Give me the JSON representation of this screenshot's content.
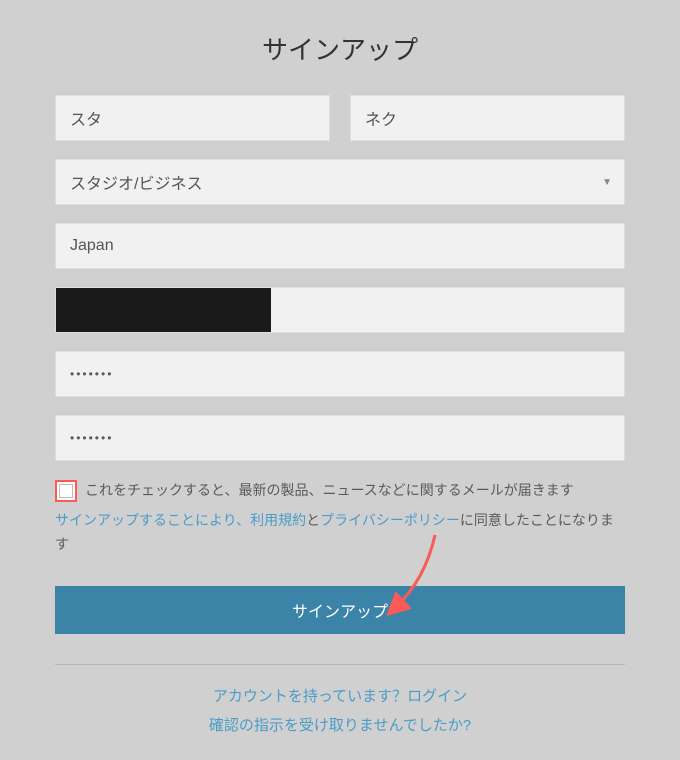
{
  "title": "サインアップ",
  "fields": {
    "first_name": {
      "value": "スタ"
    },
    "last_name": {
      "value": "ネク"
    },
    "business": {
      "label": "スタジオ/ビジネス"
    },
    "country": {
      "value": "Japan"
    },
    "password_dots": "•••••••",
    "password_confirm_dots": "•••••••"
  },
  "terms": {
    "checkbox_label": "これをチェックすると、最新の製品、ニュースなどに関するメールが届きます",
    "agree_prefix": "サインアップすることにより、",
    "tos_label": "利用規約",
    "agree_and": "と",
    "privacy_label": "プライバシーポリシー",
    "agree_suffix": "に同意したことになります"
  },
  "submit_label": "サインアップ",
  "footer": {
    "have_account": "アカウントを持っています？",
    "login_label": "ログイン",
    "confirm_resend": "確認の指示を受け取りませんでしたか?"
  }
}
